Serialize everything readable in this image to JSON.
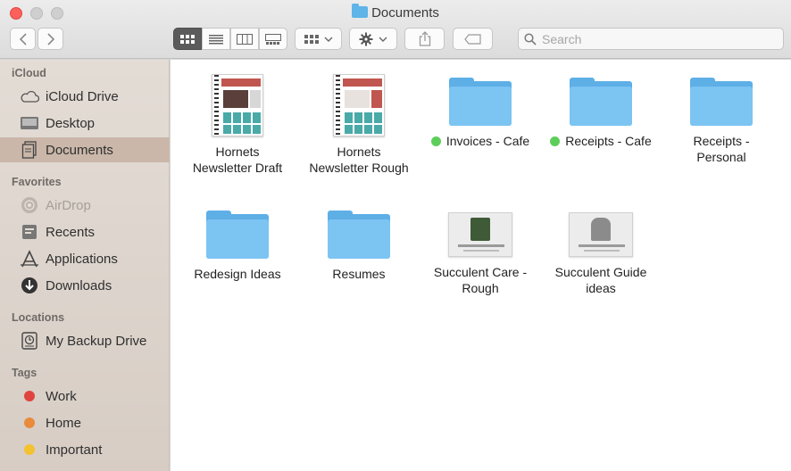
{
  "window": {
    "title": "Documents"
  },
  "toolbar": {
    "back_icon": "chevron-left-icon",
    "forward_icon": "chevron-right-icon",
    "view_modes": [
      "icon-view-icon",
      "list-view-icon",
      "column-view-icon",
      "gallery-view-icon"
    ],
    "group_icon": "group-grid-icon",
    "action_icon": "gear-icon",
    "share_icon": "share-icon",
    "tag_icon": "tag-icon",
    "search_placeholder": "Search"
  },
  "sidebar": {
    "sections": {
      "icloud": "iCloud",
      "favorites": "Favorites",
      "locations": "Locations",
      "tags": "Tags"
    },
    "icloud_items": [
      {
        "label": "iCloud Drive",
        "icon": "cloud-icon"
      },
      {
        "label": "Desktop",
        "icon": "desktop-icon"
      },
      {
        "label": "Documents",
        "icon": "documents-icon",
        "selected": true
      }
    ],
    "favorites_items": [
      {
        "label": "AirDrop",
        "icon": "airdrop-icon",
        "disabled": true
      },
      {
        "label": "Recents",
        "icon": "recents-icon"
      },
      {
        "label": "Applications",
        "icon": "applications-icon"
      },
      {
        "label": "Downloads",
        "icon": "downloads-icon"
      }
    ],
    "locations_items": [
      {
        "label": "My Backup Drive",
        "icon": "backup-drive-icon"
      }
    ],
    "tags_items": [
      {
        "label": "Work",
        "color": "#e0443e"
      },
      {
        "label": "Home",
        "color": "#e98b3a"
      },
      {
        "label": "Important",
        "color": "#f2c230"
      }
    ]
  },
  "files": [
    {
      "name_line1": "Hornets",
      "name_line2": "Newsletter Draft",
      "kind": "document"
    },
    {
      "name_line1": "Hornets",
      "name_line2": "Newsletter Rough",
      "kind": "document"
    },
    {
      "name_line1": "Invoices - Cafe",
      "name_line2": "",
      "kind": "folder",
      "tag_color": "#5ece5a"
    },
    {
      "name_line1": "Receipts - Cafe",
      "name_line2": "",
      "kind": "folder",
      "tag_color": "#5ece5a"
    },
    {
      "name_line1": "Receipts -",
      "name_line2": "Personal",
      "kind": "folder"
    },
    {
      "name_line1": "Redesign Ideas",
      "name_line2": "",
      "kind": "folder"
    },
    {
      "name_line1": "Resumes",
      "name_line2": "",
      "kind": "folder"
    },
    {
      "name_line1": "Succulent Care -",
      "name_line2": "Rough",
      "kind": "image"
    },
    {
      "name_line1": "Succulent Guide",
      "name_line2": "ideas",
      "kind": "image"
    }
  ],
  "colors": {
    "folder": "#7cc4f2",
    "selection": "#cab7a9",
    "close_button": "#fc605c"
  }
}
